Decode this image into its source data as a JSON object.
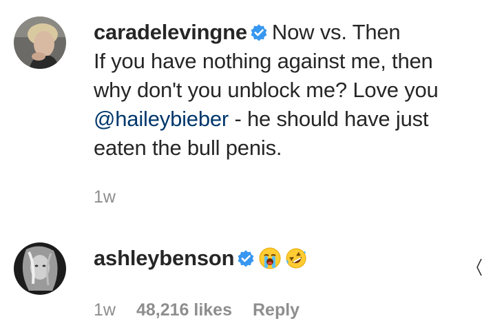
{
  "comments": [
    {
      "username": "caradelevingne",
      "verified": true,
      "text_line1": "Now vs. Then",
      "text_line2": "If you have nothing against me, then",
      "text_line3": "why don't you unblock me? Love you",
      "mention": "@haileybieber",
      "text_line4_rest": " - he should have just",
      "text_line5": "eaten the bull penis.",
      "time": "1w",
      "avatar_icon": "profile-photo"
    },
    {
      "username": "ashleybenson",
      "verified": true,
      "emojis": [
        "loudly-crying-face-icon",
        "rolling-on-floor-laughing-icon"
      ],
      "time": "1w",
      "likes": "48,216 likes",
      "reply_label": "Reply",
      "avatar_icon": "profile-photo"
    }
  ],
  "colors": {
    "text": "#262626",
    "meta": "#8e8e8e",
    "mention": "#00376b",
    "verified": "#3897f0"
  }
}
